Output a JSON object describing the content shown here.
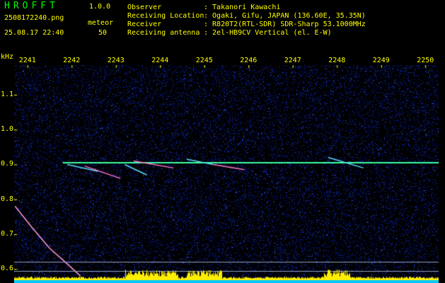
{
  "header": {
    "app_name": "HROFFT",
    "app_version": "1.0.0",
    "file_name": "2508172240.png",
    "meteor_label": "meteor",
    "datetime": "25.08.17 22:40",
    "meteor_count": "50",
    "info": [
      {
        "key": "Observer",
        "value": ": Takanori Kawachi"
      },
      {
        "key": "Receiving Location",
        "value": ": Ogaki, Gifu, JAPAN (136.60E, 35.35N)"
      },
      {
        "key": "Receiver",
        "value": ": R820T2(RTL-SDR) SDR-Sharp 53.1000MHz"
      },
      {
        "key": "Receiving antenna",
        "value": ": 2el-HB9CV Vertical (el. E-W)"
      }
    ]
  },
  "axis": {
    "y_unit": "kHz",
    "x_ticks": [
      "2241",
      "2242",
      "2243",
      "2244",
      "2245",
      "2246",
      "2247",
      "2248",
      "2249",
      "2250"
    ],
    "y_ticks": [
      "1.1",
      "1.0",
      "0.9",
      "0.8",
      "0.7",
      "0.6"
    ],
    "x_range": [
      2240.7,
      2250.3
    ],
    "y_range": [
      0.56,
      1.185
    ]
  },
  "colors": {
    "background": "#000000",
    "noise": "#0a1a8c",
    "carrier": "#3cff9c",
    "meteor": "#55ddff",
    "label": "#ffff00",
    "title": "#00ff00",
    "power_bar": "#ffee00",
    "baseline": "#00c8ff"
  },
  "chart_data": {
    "type": "heatmap",
    "x_axis": "time (minutes, HHMM)",
    "y_axis": "kHz",
    "carrier_khz": 0.905,
    "carrier_x_range": [
      2241.8,
      2250.3
    ],
    "meteor_echoes": [
      {
        "x_start": 2241.9,
        "y_start": 0.9,
        "x_end": 2242.6,
        "y_end": 0.88
      },
      {
        "x_start": 2242.3,
        "y_start": 0.895,
        "x_end": 2243.1,
        "y_end": 0.86
      },
      {
        "x_start": 2243.2,
        "y_start": 0.9,
        "x_end": 2243.7,
        "y_end": 0.87
      },
      {
        "x_start": 2243.4,
        "y_start": 0.91,
        "x_end": 2244.3,
        "y_end": 0.89
      },
      {
        "x_start": 2244.6,
        "y_start": 0.915,
        "x_end": 2245.2,
        "y_end": 0.9
      },
      {
        "x_start": 2245.2,
        "y_start": 0.9,
        "x_end": 2245.9,
        "y_end": 0.885
      },
      {
        "x_start": 2247.8,
        "y_start": 0.92,
        "x_end": 2248.6,
        "y_end": 0.89
      }
    ],
    "drift_curve": [
      [
        2240.72,
        0.78
      ],
      [
        2241.1,
        0.72
      ],
      [
        2241.5,
        0.66
      ],
      [
        2241.9,
        0.615
      ],
      [
        2242.2,
        0.58
      ]
    ]
  }
}
